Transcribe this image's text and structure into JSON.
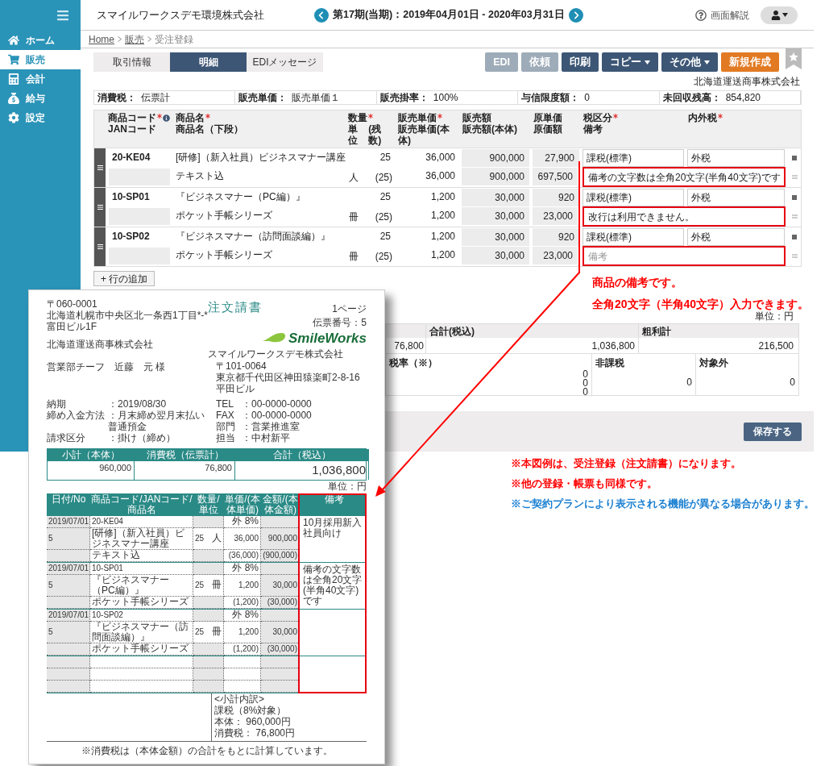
{
  "sidebar": {
    "items": [
      {
        "label": "ホーム",
        "selected": false
      },
      {
        "label": "販売",
        "selected": true
      },
      {
        "label": "会計",
        "selected": false
      },
      {
        "label": "給与",
        "selected": false
      },
      {
        "label": "設定",
        "selected": false
      }
    ]
  },
  "header": {
    "company": "スマイルワークスデモ環境株式会社",
    "period": "第17期(当期)：2019年04月01日 - 2020年03月31日",
    "help": "画面解説"
  },
  "breadcrumb": [
    "Home",
    "販売",
    "受注登録"
  ],
  "tabs": [
    {
      "label": "取引情報",
      "selected": false
    },
    {
      "label": "明細",
      "selected": true
    },
    {
      "label": "EDIメッセージ",
      "selected": false
    }
  ],
  "actions": [
    {
      "label": "EDI",
      "kind": "disabled"
    },
    {
      "label": "依頼",
      "kind": "disabled"
    },
    {
      "label": "印刷",
      "kind": "normal"
    },
    {
      "label": "コピー",
      "kind": "dropdown"
    },
    {
      "label": "その他",
      "kind": "dropdown"
    },
    {
      "label": "新規作成",
      "kind": "primary"
    }
  ],
  "customer": "北海道運送商事株式会社",
  "info": [
    {
      "label": "消費税：",
      "value": "伝票計"
    },
    {
      "label": "販売単価：",
      "value": "販売単価１"
    },
    {
      "label": "販売掛率：",
      "value": "100%"
    },
    {
      "label": "与信限度額：",
      "value": "0"
    },
    {
      "label": "未回収残高：",
      "value": "854,820"
    }
  ],
  "table": {
    "columns": [
      {
        "line1": "商品コード",
        "required": true,
        "info": true,
        "line2": "JANコード"
      },
      {
        "line1": "商品名",
        "required": true,
        "info": false,
        "line2": "商品名（下段）"
      },
      {
        "line1": "数量",
        "required": true,
        "info": false,
        "line2": "単位",
        "line2_right": "(残数)"
      },
      {
        "line1": "販売単価",
        "required": true,
        "info": false,
        "line2": "販売単価(本体)"
      },
      {
        "line1": "販売額",
        "required": false,
        "info": false,
        "line2": "販売額(本体)"
      },
      {
        "line1": "原単価",
        "required": false,
        "info": false,
        "line2": "原価額"
      },
      {
        "line1": "税区分",
        "required": true,
        "info": false,
        "line2": "備考"
      },
      {
        "line1": "内外税",
        "required": true,
        "info": false
      }
    ],
    "rows": [
      {
        "code": "20-KE04",
        "name": "[研修]（新入社員）ビジネスマナー講座",
        "qty": "25",
        "price": "36,000",
        "amount": "900,000",
        "cost": "27,900",
        "tax_class": "課税(標準)",
        "in_out": "外税",
        "name2": "テキスト込",
        "unit": "人",
        "remaining": "(25)",
        "price2": "36,000",
        "amount2": "900,000",
        "cost_amount": "697,500",
        "remark": {
          "value": "備考の文字数は全角20文字(半角40文字)です"
        }
      },
      {
        "code": "10-SP01",
        "name": "『ビジネスマナー（PC編）』",
        "qty": "25",
        "price": "1,200",
        "amount": "30,000",
        "cost": "920",
        "tax_class": "課税(標準)",
        "in_out": "外税",
        "name2": "ポケット手帳シリーズ",
        "unit": "冊",
        "remaining": "(25)",
        "price2": "1,200",
        "amount2": "30,000",
        "cost_amount": "23,000",
        "remark": {
          "value": "改行は利用できません。"
        }
      },
      {
        "code": "10-SP02",
        "name": "『ビジネスマナー（訪問面談編）』",
        "qty": "25",
        "price": "1,200",
        "amount": "30,000",
        "cost": "920",
        "tax_class": "課税(標準)",
        "in_out": "外税",
        "name2": "ポケット手帳シリーズ",
        "unit": "冊",
        "remaining": "(25)",
        "price2": "1,200",
        "amount2": "30,000",
        "cost_amount": "23,000",
        "remark": {
          "placeholder": "備考"
        }
      }
    ]
  },
  "add_row": "+ 行の追加",
  "unit_note": "単位：円",
  "summary": {
    "tax_value": "76,800",
    "total_label": "合計(税込)",
    "total": "1,036,800",
    "profit_label": "粗利計",
    "profit": "216,500",
    "rate_label": "税率（※）",
    "rate_values": [
      "0",
      "0",
      "0"
    ],
    "nontax_label": "非課税",
    "nontax": "0",
    "exempt_label": "対象外",
    "exempt": "0"
  },
  "save": "保存する",
  "callout": [
    "商品の備考です。",
    "全角20文字（半角40文字）入力できます。"
  ],
  "footnotes": [
    {
      "text": "※本図例は、受注登録（注文請書）になります。",
      "color": "#ff0000"
    },
    {
      "text": "※他の登録・帳票も同様です。",
      "color": "#ff0000"
    },
    {
      "text": "※ご契約プランにより表示される機能が異なる場合があります。",
      "color": "#1a7fd0"
    }
  ],
  "document": {
    "title": "注文請書",
    "page": "1ページ",
    "slip_no": "伝票番号：5",
    "recipient": [
      "〒060-0001",
      "北海道札幌市中央区北一条西1丁目*-*",
      "富田ビル1F"
    ],
    "recipient_company": "北海道運送商事株式会社",
    "recipient_person": "営業部チーフ　近藤　元 様",
    "logo": "SmileWorks",
    "issuer": "スマイルワークスデモ株式会社",
    "issuer_address": [
      "〒101-0064",
      "東京都千代田区神田猿楽町2-8-16",
      "平田ビル"
    ],
    "contacts": [
      {
        "label": "TEL",
        "value": "：00-0000-0000"
      },
      {
        "label": "FAX",
        "value": "：00-0000-0000"
      },
      {
        "label": "部門",
        "value": "：営業推進室"
      },
      {
        "label": "担当",
        "value": "：中村新平"
      }
    ],
    "terms": [
      {
        "label": "納期",
        "value": "：2019/08/30"
      },
      {
        "label": "締め入金方法",
        "value": "：月末締め翌月末払い普通預金"
      },
      {
        "label": "請求区分",
        "value": "：掛け（締め）"
      }
    ],
    "totals": [
      {
        "label": "小計（本体）",
        "value": "960,000"
      },
      {
        "label": "消費税（伝票計）",
        "value": "76,800"
      },
      {
        "label": "合計（税込）",
        "value": "1,036,800"
      }
    ],
    "unit": "単位：円",
    "columns": [
      "日付/No",
      "商品コード/JANコード/商品名",
      "数量/単位",
      "単価/(本体単価)",
      "金額/(本体金額)",
      "備考"
    ],
    "lines": [
      {
        "date": "2019/07/01",
        "no": "5",
        "code": "20-KE04",
        "name": "[研修]（新入社員）ビジネスマナー講座",
        "name2": "テキスト込",
        "qty": "25",
        "unit": "人",
        "tax": "外 8%",
        "price": "36,000",
        "price2": "(36,000)",
        "amount": "900,000",
        "amount2": "(900,000)",
        "remark": "10月採用新入社員向け"
      },
      {
        "date": "2019/07/01",
        "no": "5",
        "code": "10-SP01",
        "name": "『ビジネスマナー（PC編）』",
        "name2": "ポケット手帳シリーズ",
        "qty": "25",
        "unit": "冊",
        "tax": "外 8%",
        "price": "1,200",
        "price2": "(1,200)",
        "amount": "30,000",
        "amount2": "(30,000)",
        "remark": "備考の文字数は全角20文字(半角40文字)です"
      },
      {
        "date": "2019/07/01",
        "no": "5",
        "code": "10-SP02",
        "name": "『ビジネスマナー（訪問面談編）』",
        "name2": "ポケット手帳シリーズ",
        "qty": "25",
        "unit": "冊",
        "tax": "外 8%",
        "price": "1,200",
        "price2": "(1,200)",
        "amount": "30,000",
        "amount2": "(30,000)"
      }
    ],
    "breakdown": {
      "title": "<小計内訳>",
      "label": "課税（8%対象）",
      "base": "本体： 960,000円",
      "tax": "消費税： 76,800円"
    },
    "footer_note": "※消費税は（本体金額）の合計をもとに計算しています。"
  }
}
